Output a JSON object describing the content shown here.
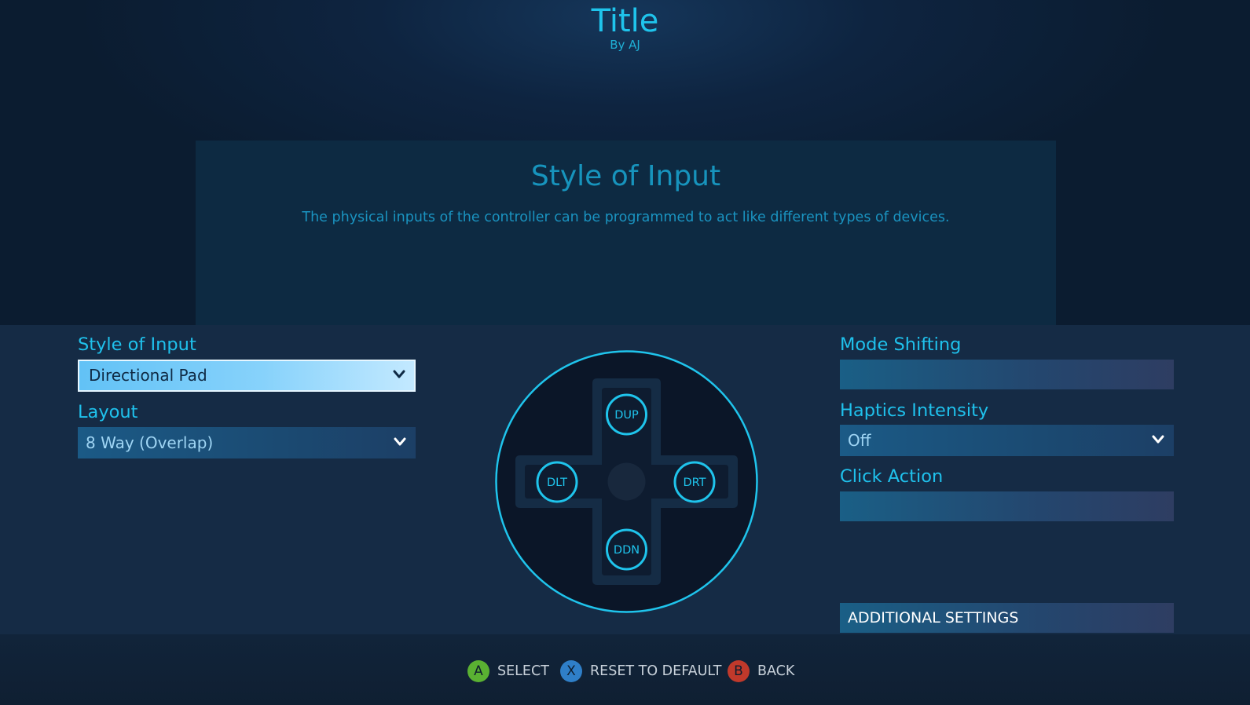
{
  "header": {
    "title": "Title",
    "author": "By AJ"
  },
  "info_panel": {
    "title": "Style of Input",
    "description": "The physical inputs of the controller can be programmed to act like different types of devices."
  },
  "left_column": {
    "style_of_input": {
      "label": "Style of Input",
      "value": "Directional Pad"
    },
    "layout": {
      "label": "Layout",
      "value": "8 Way (Overlap)"
    }
  },
  "dpad": {
    "up": "DUP",
    "down": "DDN",
    "left": "DLT",
    "right": "DRT"
  },
  "right_column": {
    "mode_shifting": {
      "label": "Mode Shifting",
      "value": ""
    },
    "haptics_intensity": {
      "label": "Haptics Intensity",
      "value": "Off"
    },
    "click_action": {
      "label": "Click Action",
      "value": ""
    },
    "additional_settings": "ADDITIONAL SETTINGS"
  },
  "footer": {
    "select": {
      "button": "A",
      "label": "SELECT",
      "color": "#5ab132"
    },
    "reset": {
      "button": "X",
      "label": "RESET TO DEFAULT",
      "color": "#2f7fc8"
    },
    "back": {
      "button": "B",
      "label": "BACK",
      "color": "#c0392b"
    }
  },
  "colors": {
    "accent": "#1fc4ec",
    "focus": "#87d2fb",
    "background": "#152b45"
  }
}
